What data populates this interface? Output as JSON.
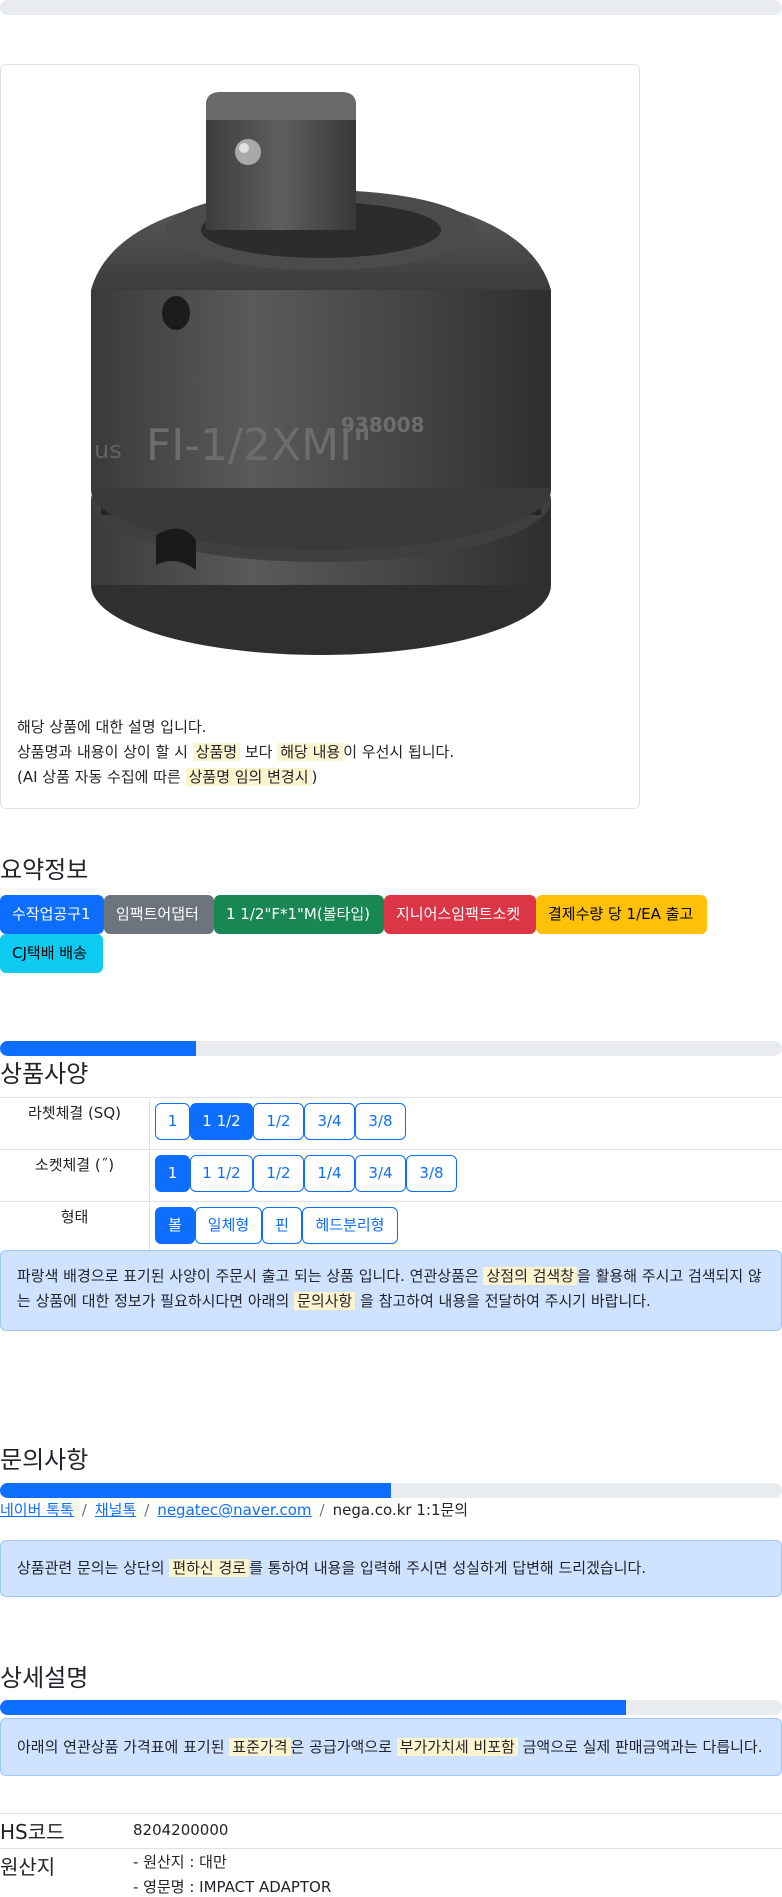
{
  "top_progress": {
    "percent": 0
  },
  "product": {
    "image_name": "impact-adaptor-photo",
    "image_texts": [
      "FI-1/2XMI\"",
      "938008",
      "us"
    ],
    "desc_line1": "해당 상품에 대한 설명 입니다.",
    "desc_line2_a": "상품명과 내용이 상이 할 시",
    "desc_line2_b": "상품명",
    "desc_line2_c": "보다",
    "desc_line2_d": "해당 내용",
    "desc_line2_e": "이 우선시 됩니다.",
    "desc_line3_a": "(AI 상품 자동 수집에 따른",
    "desc_line3_b": "상품명 임의 변경시",
    "desc_line3_c": ")"
  },
  "summary": {
    "title": "요약정보",
    "badges": [
      "수작업공구1",
      "임팩트어댑터",
      "1 1/2\"F*1\"M(볼타입)",
      "지니어스임팩트소켓",
      "결제수량 당 1/EA 출고",
      "CJ택배 배송"
    ]
  },
  "spec": {
    "progress_percent": 25,
    "title": "상품사양",
    "rows": [
      {
        "label": "라쳇체결 (SQ)",
        "options": [
          "1",
          "1 1/2",
          "1/2",
          "3/4",
          "3/8"
        ],
        "selected": 1
      },
      {
        "label": "소켓체결 (˝)",
        "options": [
          "1",
          "1 1/2",
          "1/2",
          "1/4",
          "3/4",
          "3/8"
        ],
        "selected": 0
      },
      {
        "label": "형태",
        "options": [
          "볼",
          "일체형",
          "핀",
          "헤드분리형"
        ],
        "selected": 0
      }
    ],
    "notice_a": "파랑색 배경으로 표기된 사양이 주문시 출고 되는 상품 입니다. 연관상품은",
    "notice_b": "상점의 검색창",
    "notice_c": "을 활용해 주시고 검색되지 않",
    "notice_d": "는 상품에 대한 정보가 필요하시다면 아래의",
    "notice_e": "문의사항",
    "notice_f": "을 참고하여 내용을 전달하여 주시기 바랍니다."
  },
  "inquiry": {
    "title": "문의사항",
    "progress_percent": 50,
    "links": [
      "네이버 톡톡",
      "채널톡",
      "negatec@naver.com"
    ],
    "last": "nega.co.kr 1:1문의",
    "notice_a": "상품관련 문의는 상단의",
    "notice_b": "편하신 경로",
    "notice_c": "를 통하여 내용을 입력해 주시면 성실하게 답변해 드리겠습니다."
  },
  "detail": {
    "title": "상세설명",
    "progress_percent": 80,
    "notice_a": "아래의 연관상품 가격표에 표기된",
    "notice_b": "표준가격",
    "notice_c": "은 공급가액으로",
    "notice_d": "부가가치세 비포함",
    "notice_e": "금액으로 실제 판매금액과는 다릅니다.",
    "hs_label": "HS코드",
    "hs_value": "8204200000",
    "origin_label": "원산지",
    "origin_line1": "- 원산지 : 대만",
    "origin_line2": "- 영문명 : IMPACT ADAPTOR"
  },
  "colors": {
    "primary": "#0d6efd",
    "secondary": "#6c757d",
    "success": "#198754",
    "danger": "#dc3545",
    "warning": "#ffc107",
    "info": "#0dcaf0",
    "highlight": "#fcf3cf",
    "alert_bg": "#cfe2ff"
  }
}
